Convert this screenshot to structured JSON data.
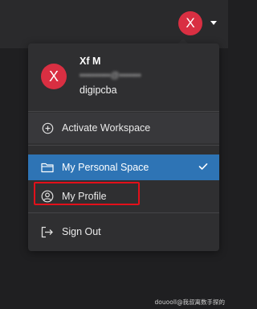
{
  "header": {
    "avatar_initial": "X"
  },
  "profile": {
    "avatar_initial": "X",
    "name": "Xf M",
    "email": "••••••••••@•••••••",
    "organization": "digipcba"
  },
  "menu": {
    "activate_workspace": "Activate Workspace",
    "personal_space": "My Personal Space",
    "my_profile": "My Profile",
    "sign_out": "Sign Out"
  },
  "colors": {
    "accent_red": "#d92f42",
    "selected_blue": "#2e74b5",
    "highlight_box": "#e3101a"
  },
  "icons": {
    "activate": "plus-circle-icon",
    "space": "folder-icon",
    "profile": "user-circle-icon",
    "signout": "sign-out-icon",
    "selected": "check-icon",
    "dropdown": "caret-down-icon"
  },
  "watermark": "douooll@我叔离数手探的"
}
